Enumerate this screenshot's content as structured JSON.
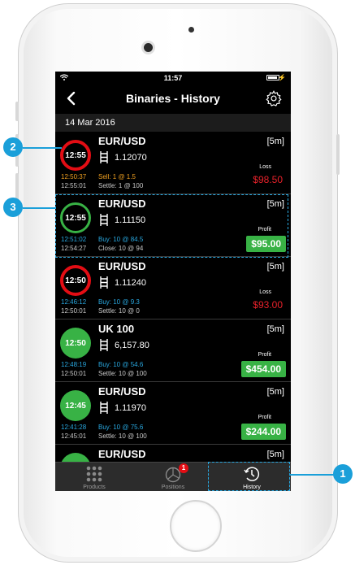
{
  "status_bar": {
    "time": "11:57"
  },
  "nav": {
    "title": "Binaries - History"
  },
  "date_header": "14 Mar 2016",
  "trades": [
    {
      "timer": "12:55",
      "timer_style": "red",
      "asset": "EUR/USD",
      "expiry": "[5m]",
      "price": "1.12070",
      "open_time": "12:50:37",
      "close_time": "12:55:01",
      "action": "Sell: 1   @ 1.5",
      "action_color": "orange",
      "settle": "Settle: 1   @ 100",
      "result_label": "Loss",
      "result_amount": "$98.50",
      "result_type": "loss"
    },
    {
      "timer": "12:55",
      "timer_style": "ring-green",
      "asset": "EUR/USD",
      "expiry": "[5m]",
      "price": "1.11150",
      "open_time": "12:51:02",
      "close_time": "12:54:27",
      "action": "Buy: 10 @ 84.5",
      "action_color": "blue",
      "settle": "Close: 10 @ 94",
      "result_label": "Profit",
      "result_amount": "$95.00",
      "result_type": "profit"
    },
    {
      "timer": "12:50",
      "timer_style": "red",
      "asset": "EUR/USD",
      "expiry": "[5m]",
      "price": "1.11240",
      "open_time": "12:46:12",
      "close_time": "12:50:01",
      "action": "Buy: 10 @ 9.3",
      "action_color": "blue",
      "settle": "Settle: 10 @ 0",
      "result_label": "Loss",
      "result_amount": "$93.00",
      "result_type": "loss"
    },
    {
      "timer": "12:50",
      "timer_style": "solid-green",
      "asset": "UK 100",
      "expiry": "[5m]",
      "price": "6,157.80",
      "open_time": "12:48:19",
      "close_time": "12:50:01",
      "action": "Buy: 10 @ 54.6",
      "action_color": "blue",
      "settle": "Settle: 10 @ 100",
      "result_label": "Profit",
      "result_amount": "$454.00",
      "result_type": "profit"
    },
    {
      "timer": "12:45",
      "timer_style": "solid-green",
      "asset": "EUR/USD",
      "expiry": "[5m]",
      "price": "1.11970",
      "open_time": "12:41:28",
      "close_time": "12:45:01",
      "action": "Buy: 10 @ 75.6",
      "action_color": "blue",
      "settle": "Settle: 10 @ 100",
      "result_label": "Profit",
      "result_amount": "$244.00",
      "result_type": "profit"
    },
    {
      "timer": "",
      "timer_style": "solid-green",
      "asset": "EUR/USD",
      "expiry": "[5m]",
      "price": "",
      "open_time": "",
      "close_time": "",
      "action": "",
      "action_color": "blue",
      "settle": "",
      "result_label": "",
      "result_amount": "",
      "result_type": "none"
    }
  ],
  "tabs": [
    {
      "label": "Products",
      "icon": "grid-icon"
    },
    {
      "label": "Positions",
      "icon": "pie-chart-icon",
      "badge": "1"
    },
    {
      "label": "History",
      "icon": "history-clock-icon"
    }
  ],
  "callouts": {
    "one": "1",
    "two": "2",
    "three": "3"
  },
  "colors": {
    "loss": "#e8212a",
    "profit": "#38b245",
    "callout": "#1a9fd9",
    "sell": "#f0a020",
    "buy": "#29a8e0"
  }
}
